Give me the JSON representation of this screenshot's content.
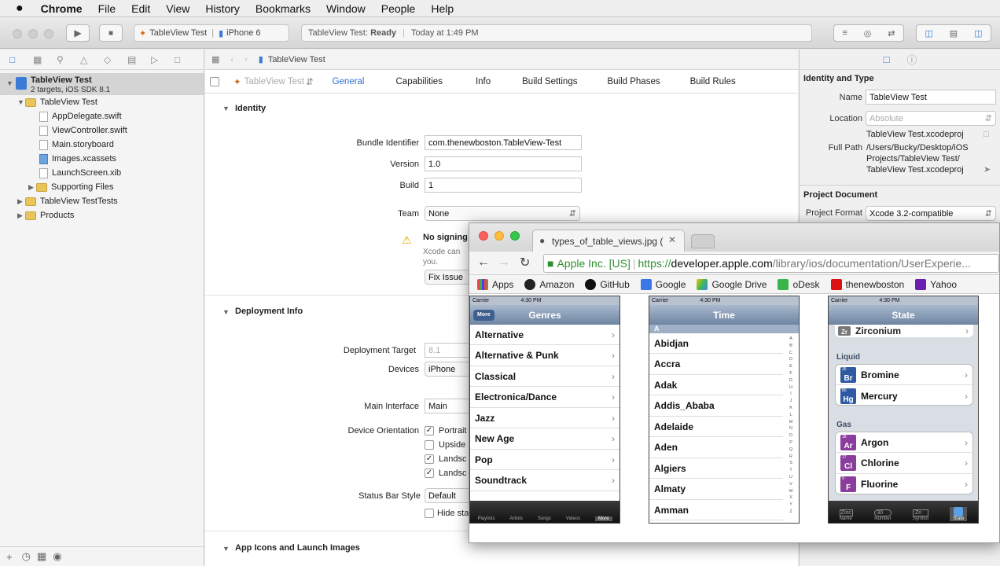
{
  "menubar": {
    "apple": "",
    "app": "Chrome",
    "items": [
      "File",
      "Edit",
      "View",
      "History",
      "Bookmarks",
      "Window",
      "People",
      "Help"
    ]
  },
  "xcode": {
    "scheme": "TableView Test",
    "device": "iPhone 6",
    "status_project": "TableView Test:",
    "status_state": "Ready",
    "status_time": "Today at 1:49 PM"
  },
  "navigator": {
    "project": "TableView Test",
    "project_sub": "2 targets, iOS SDK 8.1",
    "items": [
      {
        "label": "TableView Test",
        "type": "folder"
      },
      {
        "label": "AppDelegate.swift",
        "type": "file"
      },
      {
        "label": "ViewController.swift",
        "type": "file"
      },
      {
        "label": "Main.storyboard",
        "type": "file"
      },
      {
        "label": "Images.xcassets",
        "type": "file"
      },
      {
        "label": "LaunchScreen.xib",
        "type": "file"
      },
      {
        "label": "Supporting Files",
        "type": "folder"
      },
      {
        "label": "TableView TestTests",
        "type": "folder"
      },
      {
        "label": "Products",
        "type": "folder"
      }
    ]
  },
  "editor": {
    "breadcrumb": "TableView Test",
    "target": "TableView Test",
    "tabs": [
      "General",
      "Capabilities",
      "Info",
      "Build Settings",
      "Build Phases",
      "Build Rules"
    ],
    "identity": {
      "title": "Identity",
      "bundle_label": "Bundle Identifier",
      "bundle_value": "com.thenewboston.TableView-Test",
      "version_label": "Version",
      "version_value": "1.0",
      "build_label": "Build",
      "build_value": "1",
      "team_label": "Team",
      "team_value": "None",
      "warning_title": "No signing",
      "warning_text1": "Xcode can",
      "warning_text2": "you.",
      "fix_button": "Fix Issue"
    },
    "deployment": {
      "title": "Deployment Info",
      "target_label": "Deployment Target",
      "target_value": "8.1",
      "devices_label": "Devices",
      "devices_value": "iPhone",
      "interface_label": "Main Interface",
      "interface_value": "Main",
      "orientation_label": "Device Orientation",
      "orientations": [
        "Portrait",
        "Upside",
        "Landsc",
        "Landsc"
      ],
      "statusbar_label": "Status Bar Style",
      "statusbar_value": "Default",
      "hide_label": "Hide sta"
    },
    "icons_title": "App Icons and Launch Images"
  },
  "inspector": {
    "section1": "Identity and Type",
    "name_label": "Name",
    "name_value": "TableView Test",
    "location_label": "Location",
    "location_value": "Absolute",
    "file_name": "TableView Test.xcodeproj",
    "fullpath_label": "Full Path",
    "fullpath_1": "/Users/Bucky/Desktop/iOS",
    "fullpath_2": "Projects/TableView Test/",
    "fullpath_3": "TableView Test.xcodeproj",
    "section2": "Project Document",
    "format_label": "Project Format",
    "format_value": "Xcode 3.2-compatible"
  },
  "browser": {
    "tab_title": "types_of_table_views.jpg (",
    "ev_label": "Apple Inc. [US]",
    "url_scheme": "https://",
    "url_host": "developer.apple.com",
    "url_path": "/library/ios/documentation/UserExperie...",
    "bookmarks": [
      "Apps",
      "Amazon",
      "GitHub",
      "Google",
      "Google Drive",
      "oDesk",
      "thenewboston",
      "Yahoo"
    ],
    "phone_carrier": "Carrier",
    "phone_time": "4:30 PM",
    "phone1": {
      "back": "More",
      "title": "Genres",
      "rows": [
        "Alternative",
        "Alternative & Punk",
        "Classical",
        "Electronica/Dance",
        "Jazz",
        "New Age",
        "Pop",
        "Soundtrack"
      ],
      "tabs": [
        "Playlists",
        "Artists",
        "Songs",
        "Videos",
        "More"
      ]
    },
    "phone2": {
      "title": "Time",
      "section": "A",
      "rows": [
        "Abidjan",
        "Accra",
        "Adak",
        "Addis_Ababa",
        "Adelaide",
        "Aden",
        "Algiers",
        "Almaty",
        "Amman"
      ],
      "index": [
        "A",
        "B",
        "C",
        "D",
        "E",
        "F",
        "G",
        "H",
        "I",
        "J",
        "K",
        "L",
        "M",
        "N",
        "O",
        "P",
        "Q",
        "R",
        "S",
        "T",
        "U",
        "V",
        "W",
        "X",
        "Y",
        "Z"
      ]
    },
    "phone3": {
      "title": "State",
      "top_row": "Zirconium",
      "top_sym": "Zr",
      "liquid": "Liquid",
      "gas": "Gas",
      "liquids": [
        {
          "sym": "Br",
          "num": "35",
          "name": "Bromine",
          "color": "#2f5aa3"
        },
        {
          "sym": "Hg",
          "num": "80",
          "name": "Mercury",
          "color": "#2f5aa3"
        }
      ],
      "gases": [
        {
          "sym": "Ar",
          "num": "18",
          "name": "Argon",
          "color": "#8a3d9c"
        },
        {
          "sym": "Cl",
          "num": "17",
          "name": "Chlorine",
          "color": "#8a3d9c"
        },
        {
          "sym": "F",
          "num": "9",
          "name": "Fluorine",
          "color": "#8a3d9c"
        }
      ],
      "tabs": [
        "Name",
        "Number",
        "Symbol",
        "State"
      ],
      "tab_icons": [
        "Zinc",
        "30",
        "Zn",
        ""
      ]
    }
  }
}
